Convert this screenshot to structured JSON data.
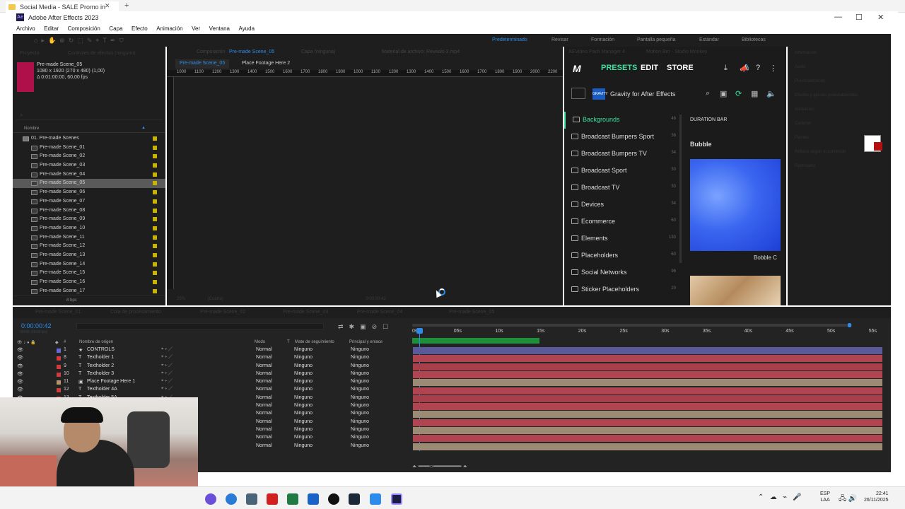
{
  "browser": {
    "tab_title": "Social Media - SALE Promo in"
  },
  "window": {
    "title": "Adobe After Effects 2023"
  },
  "menu": [
    "Archivo",
    "Editar",
    "Composición",
    "Capa",
    "Efecto",
    "Animación",
    "Ver",
    "Ventana",
    "Ayuda"
  ],
  "workspaces": [
    "Predeterminado",
    "Revisar",
    "Formación",
    "Pantalla pequeña",
    "Estándar",
    "Bibliotecas"
  ],
  "project": {
    "tab": "Proyecto",
    "tab2": "Controles de efectos (ninguno)",
    "selected_name": "Pre-made Scene_05",
    "dims": "1080 x 1920 (270 x 480) (1,00)",
    "duration": "Δ 0:01:00:00, 60,00 fps",
    "col_name": "Nombre",
    "folder": "01. Pre-made Scenes",
    "items": [
      "Pre-made Scene_01",
      "Pre-made Scene_02",
      "Pre-made Scene_03",
      "Pre-made Scene_04",
      "Pre-made Scene_05",
      "Pre-made Scene_06",
      "Pre-made Scene_07",
      "Pre-made Scene_08",
      "Pre-made Scene_09",
      "Pre-made Scene_10",
      "Pre-made Scene_11",
      "Pre-made Scene_12",
      "Pre-made Scene_13",
      "Pre-made Scene_14",
      "Pre-made Scene_15",
      "Pre-made Scene_16",
      "Pre-made Scene_17"
    ],
    "selected_index": 4,
    "bpc": "8 bpc"
  },
  "composition": {
    "tab_label": "Composición",
    "tab_active": "Pre-made Scene_05",
    "tab_other1": "Capa (ninguna)",
    "tab_other2": "Material de archivo: Reveals-3.mp4",
    "sub_active": "Pre-made Scene_05",
    "sub_other": "Place Footage Here 2",
    "ruler": [
      "1000",
      "1100",
      "1200",
      "1300",
      "1400",
      "1500",
      "1600",
      "1700",
      "1800",
      "1900",
      "1000",
      "1100",
      "1200",
      "1300",
      "1400",
      "1500",
      "1600",
      "1700",
      "1800",
      "1900",
      "2000",
      "2200"
    ],
    "zoom": "25%",
    "quality": "(Cuarta)",
    "time": "0:00:00:42"
  },
  "motion": {
    "tab1": "AEVideo Pack Manager 4",
    "tab2": "Motion Bro - Studio Monkey",
    "nav": [
      "PRESETS",
      "EDIT",
      "STORE"
    ],
    "product": "Gravity for After Effects",
    "badge": "GRAVITY",
    "categories": [
      {
        "name": "Backgrounds",
        "count": "46"
      },
      {
        "name": "Broadcast Bumpers Sport",
        "count": "36"
      },
      {
        "name": "Broadcast Bumpers TV",
        "count": "34"
      },
      {
        "name": "Broadcast Sport",
        "count": "30"
      },
      {
        "name": "Broadcast TV",
        "count": "33"
      },
      {
        "name": "Devices",
        "count": "34"
      },
      {
        "name": "Ecommerce",
        "count": "60"
      },
      {
        "name": "Elements",
        "count": "133"
      },
      {
        "name": "Placeholders",
        "count": "60"
      },
      {
        "name": "Social Networks",
        "count": "96"
      },
      {
        "name": "Sticker Placeholders",
        "count": "20"
      }
    ],
    "active_index": 0,
    "section": "DURATION BAR",
    "preset_name": "Bubble",
    "preview_caption": "Bobble C"
  },
  "info_panel": [
    "Información",
    "Audio",
    "Previsualización",
    "Efectos y ajustes preestablecidos",
    "Alineación",
    "Carácter",
    "Párrafo",
    "Relleno según el contenido",
    "Rastreador"
  ],
  "timeline": {
    "tabs": [
      "Pre-made Scene_01",
      "Cola de procesamiento",
      "Pre-made Scene_02",
      "Pre-made Scene_03",
      "Pre-made Scene_04",
      "Pre-made Scene_05"
    ],
    "time": "0:00:00:42",
    "fps": "00042 (60.00 fps)",
    "col_source": "Nombre de origen",
    "col_mode": "Modo",
    "col_t": "T",
    "col_mate": "Mate de seguimiento",
    "col_parent": "Principal y enlace",
    "ruler": [
      "0s",
      "05s",
      "10s",
      "15s",
      "20s",
      "25s",
      "30s",
      "35s",
      "40s",
      "45s",
      "50s",
      "55s"
    ],
    "layers": [
      {
        "num": "1",
        "type": "★",
        "name": "CONTROLS",
        "color": "#6a6adc",
        "mode": "Normal",
        "mate": "Ninguno",
        "parent": "Ninguno"
      },
      {
        "num": "8",
        "type": "T",
        "name": "Textholder 1",
        "color": "#d23c3c",
        "mode": "Normal",
        "mate": "Ninguno",
        "parent": "Ninguno"
      },
      {
        "num": "9",
        "type": "T",
        "name": "Textholder 2",
        "color": "#d23c3c",
        "mode": "Normal",
        "mate": "Ninguno",
        "parent": "Ninguno"
      },
      {
        "num": "10",
        "type": "T",
        "name": "Textholder 3",
        "color": "#d23c3c",
        "mode": "Normal",
        "mate": "Ninguno",
        "parent": "Ninguno"
      },
      {
        "num": "11",
        "type": "▣",
        "name": "Place Footage Here 1",
        "color": "#b4966e",
        "mode": "Normal",
        "mate": "Ninguno",
        "parent": "Ninguno"
      },
      {
        "num": "12",
        "type": "T",
        "name": "Textholder 4A",
        "color": "#d23c3c",
        "mode": "Normal",
        "mate": "Ninguno",
        "parent": "Ninguno"
      },
      {
        "num": "13",
        "type": "T",
        "name": "Textholder 5A",
        "color": "#d23c3c",
        "mode": "Normal",
        "mate": "Ninguno",
        "parent": "Ninguno"
      },
      {
        "num": "",
        "type": "",
        "name": "",
        "color": "#d23c3c",
        "mode": "Normal",
        "mate": "Ninguno",
        "parent": "Ninguno"
      },
      {
        "num": "",
        "type": "",
        "name": "",
        "color": "#d23c3c",
        "mode": "Normal",
        "mate": "Ninguno",
        "parent": "Ninguno"
      },
      {
        "num": "",
        "type": "",
        "name": "",
        "color": "#d23c3c",
        "mode": "Normal",
        "mate": "Ninguno",
        "parent": "Ninguno"
      },
      {
        "num": "",
        "type": "",
        "name": "",
        "color": "#d23c3c",
        "mode": "Normal",
        "mate": "Ninguno",
        "parent": "Ninguno"
      },
      {
        "num": "",
        "type": "",
        "name": "",
        "color": "#d23c3c",
        "mode": "Normal",
        "mate": "Ninguno",
        "parent": "Ninguno"
      },
      {
        "num": "",
        "type": "",
        "name": "",
        "color": "#d23c3c",
        "mode": "Normal",
        "mate": "Ninguno",
        "parent": "Ninguno"
      }
    ]
  },
  "taskbar": {
    "lang": "ESP",
    "lang2": "LAA",
    "time": "22:41",
    "date": "26/11/2025"
  }
}
